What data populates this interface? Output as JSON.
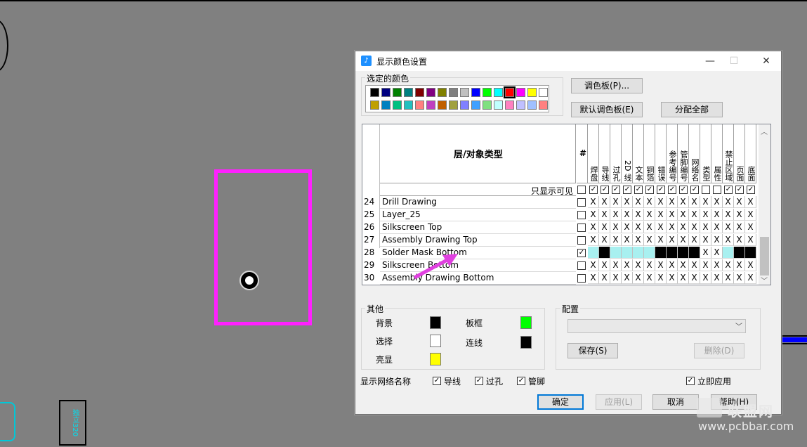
{
  "dialog": {
    "title": "显示颜色设置",
    "title_icon": "palette-app-icon",
    "window_controls": {
      "minimize": "—",
      "maximize": "☐",
      "close": "✕"
    }
  },
  "selected_colors": {
    "label": "选定的颜色",
    "palette_row1": [
      "#000000",
      "#000080",
      "#008000",
      "#008080",
      "#800000",
      "#800080",
      "#808000",
      "#808080",
      "#c0c0c0",
      "#0000ff",
      "#00ff00",
      "#00ffff",
      "#ff0000",
      "#ff00ff",
      "#ffff00",
      "#ffffff"
    ],
    "palette_row2": [
      "#c0a000",
      "#0080c0",
      "#00c080",
      "#20c0c0",
      "#ff8080",
      "#c040c0",
      "#c06000",
      "#a0a040",
      "#8080ff",
      "#40a0ff",
      "#80e080",
      "#c0ffff",
      "#ff80c0",
      "#c0c0ff",
      "#a0c0ff",
      "#ff8080"
    ],
    "selected_color": "#ff0000"
  },
  "buttons": {
    "palette": "调色板(P)...",
    "default_palette": "默认调色板(E)",
    "assign_all": "分配全部",
    "save": "保存(S)",
    "delete": "删除(D)",
    "ok": "确定",
    "apply": "应用(L)",
    "cancel": "取消",
    "help": "帮助(H)"
  },
  "grid": {
    "header_title": "层/对象类型",
    "hash_label": "#",
    "columns": [
      "焊盘",
      "导线",
      "过孔",
      "2D 线",
      "文本",
      "铜箔",
      "错误",
      "参考编号",
      "管脚编号",
      "网络名",
      "类型",
      "属性",
      "禁止区域",
      "页面",
      "底面"
    ],
    "visible_only_label": "只显示可见",
    "visible_only_checks": [
      true,
      true,
      true,
      true,
      true,
      true,
      true,
      true,
      true,
      true,
      false,
      false,
      true,
      true,
      true
    ],
    "rows": [
      {
        "num": "24",
        "name": "Drill Drawing",
        "checked": false,
        "cells": [
          "X",
          "X",
          "X",
          "X",
          "X",
          "X",
          "X",
          "X",
          "X",
          "X",
          "X",
          "X",
          "X",
          "X",
          "X"
        ]
      },
      {
        "num": "25",
        "name": "Layer_25",
        "checked": false,
        "cells": [
          "X",
          "X",
          "X",
          "X",
          "X",
          "X",
          "X",
          "X",
          "X",
          "X",
          "X",
          "X",
          "X",
          "X",
          "X"
        ]
      },
      {
        "num": "26",
        "name": "Silkscreen Top",
        "checked": false,
        "cells": [
          "X",
          "X",
          "X",
          "X",
          "X",
          "X",
          "X",
          "X",
          "X",
          "X",
          "X",
          "X",
          "X",
          "X",
          "X"
        ]
      },
      {
        "num": "27",
        "name": "Assembly Drawing Top",
        "checked": false,
        "cells": [
          "X",
          "X",
          "X",
          "X",
          "X",
          "X",
          "X",
          "X",
          "X",
          "X",
          "X",
          "X",
          "X",
          "X",
          "X"
        ]
      },
      {
        "num": "28",
        "name": "Solder Mask Bottom",
        "checked": true,
        "cells": [
          "",
          "",
          "",
          "",
          "",
          "",
          "",
          "",
          "",
          "",
          "X",
          "X",
          "",
          "",
          ""
        ],
        "colors": [
          "#a8f0f0",
          "#000000",
          "#a8f0f0",
          "#a8f0f0",
          "#a8f0f0",
          "#a8f0f0",
          "#000000",
          "#000000",
          "#000000",
          "#000000",
          "#ffffff",
          "#ffffff",
          "#a8f0f0",
          "#000000",
          "#000000"
        ]
      },
      {
        "num": "29",
        "name": "Silkscreen Bottom",
        "checked": false,
        "cells": [
          "X",
          "X",
          "X",
          "X",
          "X",
          "X",
          "X",
          "X",
          "X",
          "X",
          "X",
          "X",
          "X",
          "X",
          "X"
        ]
      },
      {
        "num": "30",
        "name": "Assembly Drawing Bottom",
        "checked": false,
        "cells": [
          "X",
          "X",
          "X",
          "X",
          "X",
          "X",
          "X",
          "X",
          "X",
          "X",
          "X",
          "X",
          "X",
          "X",
          "X"
        ]
      }
    ]
  },
  "other": {
    "label": "其他",
    "background": {
      "label": "背景",
      "color": "#000000"
    },
    "selection": {
      "label": "选择",
      "color": "#ffffff"
    },
    "highlight": {
      "label": "亮显",
      "color": "#ffff00"
    },
    "board_frame": {
      "label": "板框",
      "color": "#00ff00"
    },
    "connection": {
      "label": "连线",
      "color": "#000000"
    }
  },
  "config": {
    "label": "配置",
    "selected_value": ""
  },
  "net_names": {
    "label": "显示网络名称",
    "traces": {
      "label": "导线",
      "checked": true
    },
    "vias": {
      "label": "过孔",
      "checked": true
    },
    "pins": {
      "label": "管脚",
      "checked": true
    }
  },
  "apply_immediately": {
    "label": "立即应用",
    "checked": true
  },
  "canvas": {
    "component_label": "独立320",
    "board_outline_color": "#ff20ff",
    "arrow_color": "#e040e0"
  },
  "watermark": {
    "brand": "联盟网",
    "url": "www.pcbbar.com"
  }
}
